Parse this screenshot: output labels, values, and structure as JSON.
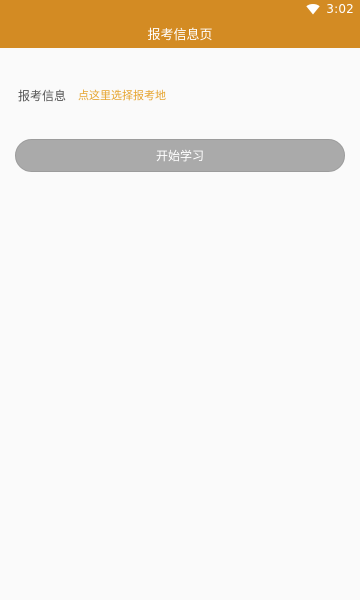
{
  "status_bar": {
    "time": "3:02",
    "wifi_icon": "wifi-icon"
  },
  "app_bar": {
    "title": "报考信息页"
  },
  "exam_info": {
    "label": "报考信息",
    "select_link": "点这里选择报考地"
  },
  "actions": {
    "start_label": "开始学习"
  },
  "colors": {
    "primary": "#d38b23",
    "link": "#e6a531",
    "button_bg": "#aaaaaa"
  }
}
